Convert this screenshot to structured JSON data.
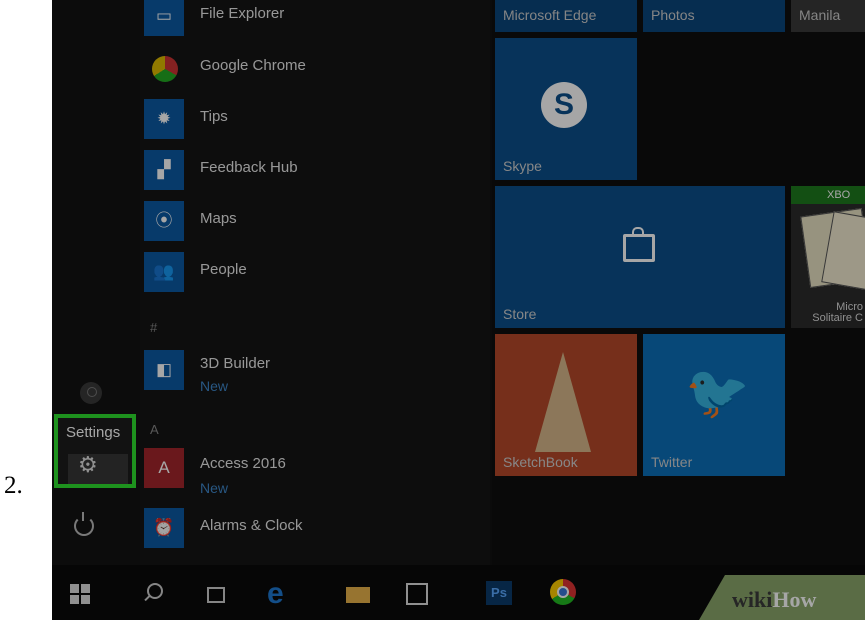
{
  "step_number": "2.",
  "rail": {
    "settings_label": "Settings"
  },
  "apps": [
    {
      "name": "File Explorer",
      "sub": ""
    },
    {
      "name": "Google Chrome",
      "sub": ""
    },
    {
      "name": "Tips",
      "sub": ""
    },
    {
      "name": "Feedback Hub",
      "sub": ""
    },
    {
      "name": "Maps",
      "sub": ""
    },
    {
      "name": "People",
      "sub": ""
    },
    {
      "name": "3D Builder",
      "sub": "New"
    },
    {
      "name": "Access 2016",
      "sub": "New"
    },
    {
      "name": "Alarms & Clock",
      "sub": ""
    }
  ],
  "letters": {
    "hash": "#",
    "a": "A"
  },
  "tiles": {
    "top_labels": [
      "Microsoft Edge",
      "Photos",
      "Manila"
    ],
    "skype": "Skype",
    "store": "Store",
    "sketchbook": "SketchBook",
    "twitter": "Twitter",
    "xbox": "XBO",
    "solitaire": "Micro\nSolitaire C"
  },
  "taskbar": {
    "ps_label": "Ps"
  },
  "watermark": {
    "prefix": "wiki",
    "suffix": "How"
  },
  "colors": {
    "accent": "#0b4f8a",
    "highlight": "#2ee02e"
  }
}
